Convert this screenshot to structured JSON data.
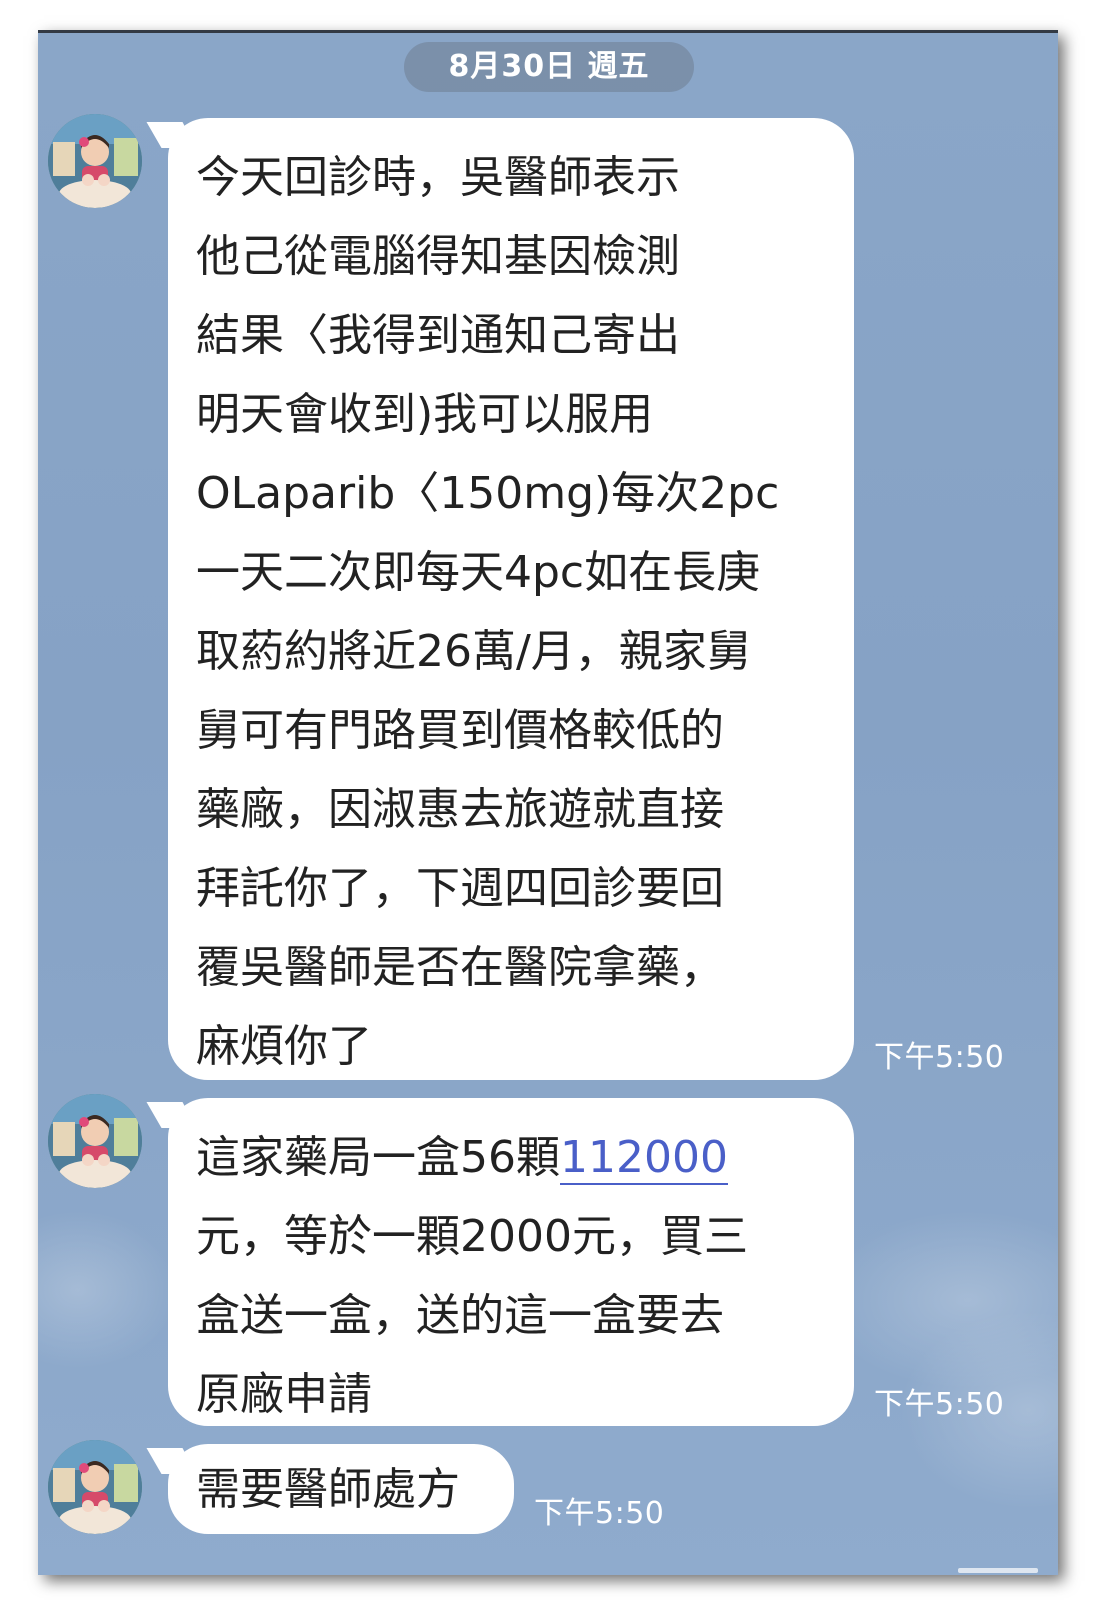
{
  "date_separator": "8月30日 週五",
  "messages": [
    {
      "lines": [
        "今天回診時，吳醫師表示",
        "他己從電腦得知基因檢測",
        "結果〈我得到通知己寄出",
        "明天會收到)我可以服用",
        "OLaparib〈150mg)每次2pc",
        "一天二次即每天4pc如在長庚",
        "取葯約將近26萬/月，親家舅",
        "舅可有門路買到價格較低的",
        "藥廠，因淑惠去旅遊就直接",
        "拜託你了，下週四回診要回",
        "覆吳醫師是否在醫院拿藥，",
        "麻煩你了"
      ],
      "time": "下午5:50"
    },
    {
      "line1_prefix": "這家藥局一盒56顆",
      "line1_link": "112000",
      "lines": [
        "元，等於一顆2000元，買三",
        "盒送一盒，送的這一盒要去",
        "原廠申請"
      ],
      "time": "下午5:50"
    },
    {
      "lines": [
        "需要醫師處方"
      ],
      "time": "下午5:50"
    }
  ],
  "colors": {
    "background": "#8aa6c8",
    "bubble": "#ffffff",
    "link": "#4a5fc8",
    "time_text": "#ffffff"
  },
  "icons": {
    "avatar": "child-photo-avatar"
  }
}
